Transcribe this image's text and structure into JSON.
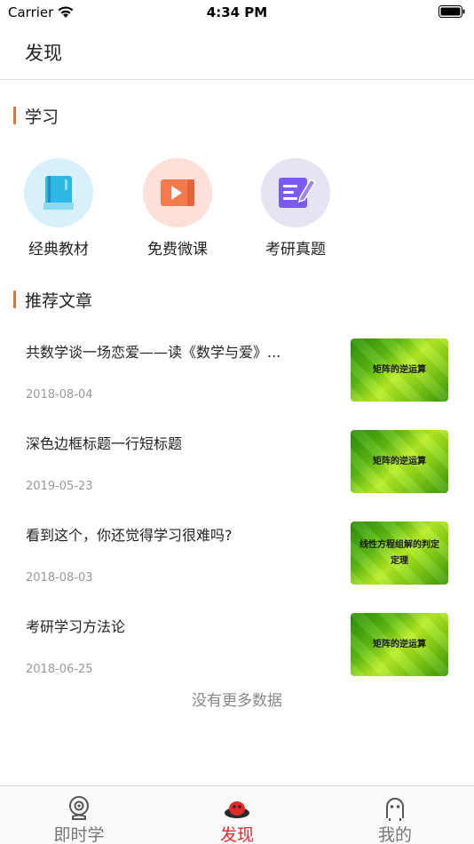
{
  "status_bar": {
    "carrier": "Carrier",
    "time": "4:34 PM"
  },
  "header": {
    "title": "发现"
  },
  "learning": {
    "title": "学习",
    "items": [
      {
        "label": "经典教材",
        "icon": "book-icon",
        "color": "#2fb7e6",
        "bg": "#d7f1fb"
      },
      {
        "label": "免费微课",
        "icon": "video-icon",
        "color": "#f27a4d",
        "bg": "#fde1d8"
      },
      {
        "label": "考研真题",
        "icon": "edit-icon",
        "color": "#7c5cf0",
        "bg": "#e4e4f2"
      }
    ]
  },
  "articles": {
    "title": "推荐文章",
    "items": [
      {
        "title": "共数学谈一场恋爱——读《数学与爱》...",
        "date": "2018-08-04",
        "thumb_text": "矩阵的逆运算"
      },
      {
        "title": "深色边框标题一行短标题",
        "date": "2019-05-23",
        "thumb_text": "矩阵的逆运算"
      },
      {
        "title": "看到这个，你还觉得学习很难吗?",
        "date": "2018-08-03",
        "thumb_text": "线性方程组解的判定定理"
      },
      {
        "title": "考研学习方法论",
        "date": "2018-06-25",
        "thumb_text": "矩阵的逆运算"
      }
    ],
    "footer": "没有更多数据"
  },
  "tab_bar": {
    "tabs": [
      {
        "label": "即时学",
        "icon": "webcam-icon",
        "active": false
      },
      {
        "label": "发现",
        "icon": "discover-icon",
        "active": true
      },
      {
        "label": "我的",
        "icon": "profile-icon",
        "active": false
      }
    ]
  },
  "colors": {
    "accent": "#f26a2a",
    "active_tab": "#e02b2b"
  }
}
